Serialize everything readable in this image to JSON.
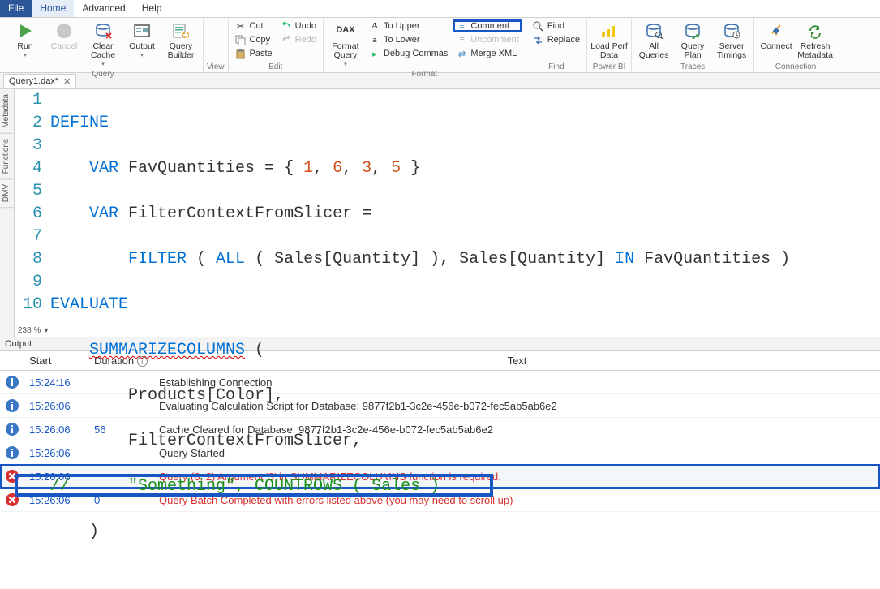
{
  "menu": {
    "file": "File",
    "home": "Home",
    "advanced": "Advanced",
    "help": "Help"
  },
  "ribbon": {
    "query": {
      "label": "Query",
      "run": "Run",
      "cancel": "Cancel",
      "clear_cache": "Clear\nCache",
      "output": "Output",
      "query_builder": "Query\nBuilder"
    },
    "view": {
      "label": "View"
    },
    "edit": {
      "label": "Edit",
      "cut": "Cut",
      "copy": "Copy",
      "paste": "Paste",
      "undo": "Undo",
      "redo": "Redo"
    },
    "format": {
      "label": "Format",
      "format_query": "Format\nQuery",
      "upper": "To Upper",
      "lower": "To Lower",
      "debug": "Debug Commas",
      "comment": "Comment",
      "uncomment": "Uncomment",
      "merge": "Merge XML"
    },
    "find": {
      "label": "Find",
      "find": "Find",
      "replace": "Replace"
    },
    "powerbi": {
      "label": "Power BI",
      "load": "Load Perf\nData"
    },
    "traces": {
      "label": "Traces",
      "all": "All\nQueries",
      "plan": "Query\nPlan",
      "timings": "Server\nTimings"
    },
    "connection": {
      "label": "Connection",
      "connect": "Connect",
      "refresh": "Refresh\nMetadata"
    }
  },
  "doctab": {
    "name": "Query1.dax*",
    "close": "✕"
  },
  "sidetabs": {
    "meta": "Metadata",
    "func": "Functions",
    "dmv": "DMV"
  },
  "code": {
    "lines": [
      "1",
      "2",
      "3",
      "4",
      "5",
      "6",
      "7",
      "8",
      "9",
      "10"
    ],
    "l1": "DEFINE",
    "l2_var": "VAR",
    "l2_rest": " FavQuantities = { ",
    "l2_n1": "1",
    "l2_c": ", ",
    "l2_n2": "6",
    "l2_n3": "3",
    "l2_n4": "5",
    "l2_end": " }",
    "l3_var": "VAR",
    "l3_rest": " FilterContextFromSlicer =",
    "l4_pad": "        ",
    "l4_f1": "FILTER",
    "l4_a": " ( ",
    "l4_f2": "ALL",
    "l4_b": " ( Sales[Quantity] ), Sales[Quantity] ",
    "l4_in": "IN",
    "l4_c": " FavQuantities )",
    "l5": "EVALUATE",
    "l6_pad": "    ",
    "l6_fn": "SUMMARIZECOLUMNS",
    "l6_b": " (",
    "l7": "        Products[Color],",
    "l8": "        FilterContextFromSlicer,",
    "l9": "//      \"Something\", COUNTROWS ( Sales )",
    "l10": "    )"
  },
  "zoom": "238 %",
  "output": {
    "title": "Output",
    "cols": {
      "start": "Start",
      "duration": "Duration",
      "text": "Text"
    },
    "rows": [
      {
        "type": "info",
        "start": "15:24:16",
        "dur": "",
        "text": "Establishing Connection"
      },
      {
        "type": "info",
        "start": "15:26:06",
        "dur": "",
        "text": "Evaluating Calculation Script for Database: 9877f2b1-3c2e-456e-b072-fec5ab5ab6e2"
      },
      {
        "type": "info",
        "start": "15:26:06",
        "dur": "56",
        "text": "Cache Cleared for Database: 9877f2b1-3c2e-456e-b072-fec5ab5ab6e2"
      },
      {
        "type": "info",
        "start": "15:26:06",
        "dur": "",
        "text": "Query Started"
      },
      {
        "type": "err",
        "start": "15:26:06",
        "dur": "",
        "text": "Query (6, 2) Argument '3' in SUMMARIZECOLUMNS function is required.",
        "hi": true
      },
      {
        "type": "err",
        "start": "15:26:06",
        "dur": "0",
        "text": "Query Batch Completed with errors listed above (you may need to scroll up)"
      }
    ]
  }
}
